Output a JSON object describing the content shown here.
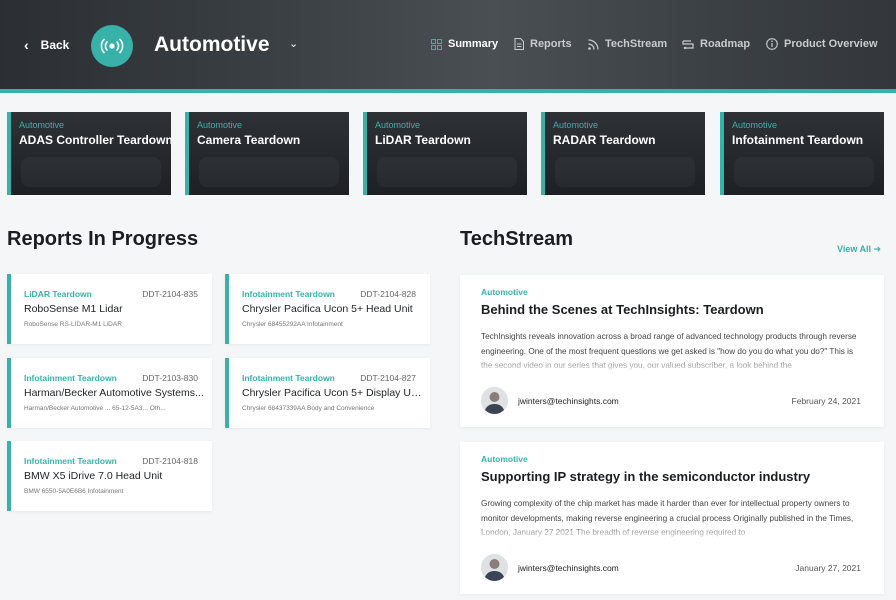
{
  "header": {
    "back_label": "Back",
    "title": "Automotive",
    "nav": [
      {
        "label": "Summary",
        "icon": "grid-icon",
        "active": true
      },
      {
        "label": "Reports",
        "icon": "document-icon",
        "active": false
      },
      {
        "label": "TechStream",
        "icon": "rss-icon",
        "active": false
      },
      {
        "label": "Roadmap",
        "icon": "roadmap-icon",
        "active": false
      },
      {
        "label": "Product Overview",
        "icon": "info-icon",
        "active": false
      }
    ]
  },
  "categories": [
    {
      "kicker": "Automotive",
      "name": "ADAS Controller Teardown"
    },
    {
      "kicker": "Automotive",
      "name": "Camera Teardown"
    },
    {
      "kicker": "Automotive",
      "name": "LiDAR Teardown"
    },
    {
      "kicker": "Automotive",
      "name": "RADAR Teardown"
    },
    {
      "kicker": "Automotive",
      "name": "Infotainment Teardown"
    }
  ],
  "reports_section": {
    "title": "Reports In Progress",
    "items": [
      {
        "type": "LiDAR Teardown",
        "code": "DDT-2104-835",
        "name": "RoboSense M1 Lidar",
        "meta": "RoboSense  RS-LIDAR-M1  LiDAR"
      },
      {
        "type": "Infotainment Teardown",
        "code": "DDT-2104-828",
        "name": "Chrysler Pacifica Ucon 5+ Head Unit",
        "meta": "Chrysler  68455292AA  Infotainment"
      },
      {
        "type": "Infotainment Teardown",
        "code": "DDT-2103-830",
        "name": "Harman/Becker Automotive Systems...",
        "meta": "Harman/Becker Automotive ...   65-12-5A3...   Oth..."
      },
      {
        "type": "Infotainment Teardown",
        "code": "DDT-2104-827",
        "name": "Chrysler Pacifica Ucon 5+ Display Unit",
        "meta": "Chrysler  68437339AA  Body and Convenience"
      },
      {
        "type": "Infotainment Teardown",
        "code": "DDT-2104-818",
        "name": "BMW X5 iDrive 7.0 Head Unit",
        "meta": "BMW  6550-5A0E6B6  Infotainment"
      }
    ]
  },
  "techstream_section": {
    "title": "TechStream",
    "view_all": "View All",
    "items": [
      {
        "tag": "Automotive",
        "headline": "Behind the Scenes at TechInsights: Teardown",
        "excerpt": "TechInsights reveals innovation across a broad range of advanced technology products through reverse engineering. One of the most frequent questions we get asked is \"how do you do what you do?\" This is the second video in our series that gives you, our valued subscriber, a look behind the",
        "author": "jwinters@techinsights.com",
        "date": "February 24, 2021"
      },
      {
        "tag": "Automotive",
        "headline": "Supporting IP strategy in the semiconductor industry",
        "excerpt": "Growing complexity of the chip market has made it harder than ever for intellectual property owners to monitor developments, making reverse engineering a crucial process Originally published in the Times, London, January 27 2021 The breadth of reverse engineering required to",
        "author": "jwinters@techinsights.com",
        "date": "January 27, 2021"
      }
    ]
  },
  "colors": {
    "accent": "#38b2a9",
    "header_bg": "#3a3f44",
    "page_bg": "#f5f6f7"
  }
}
